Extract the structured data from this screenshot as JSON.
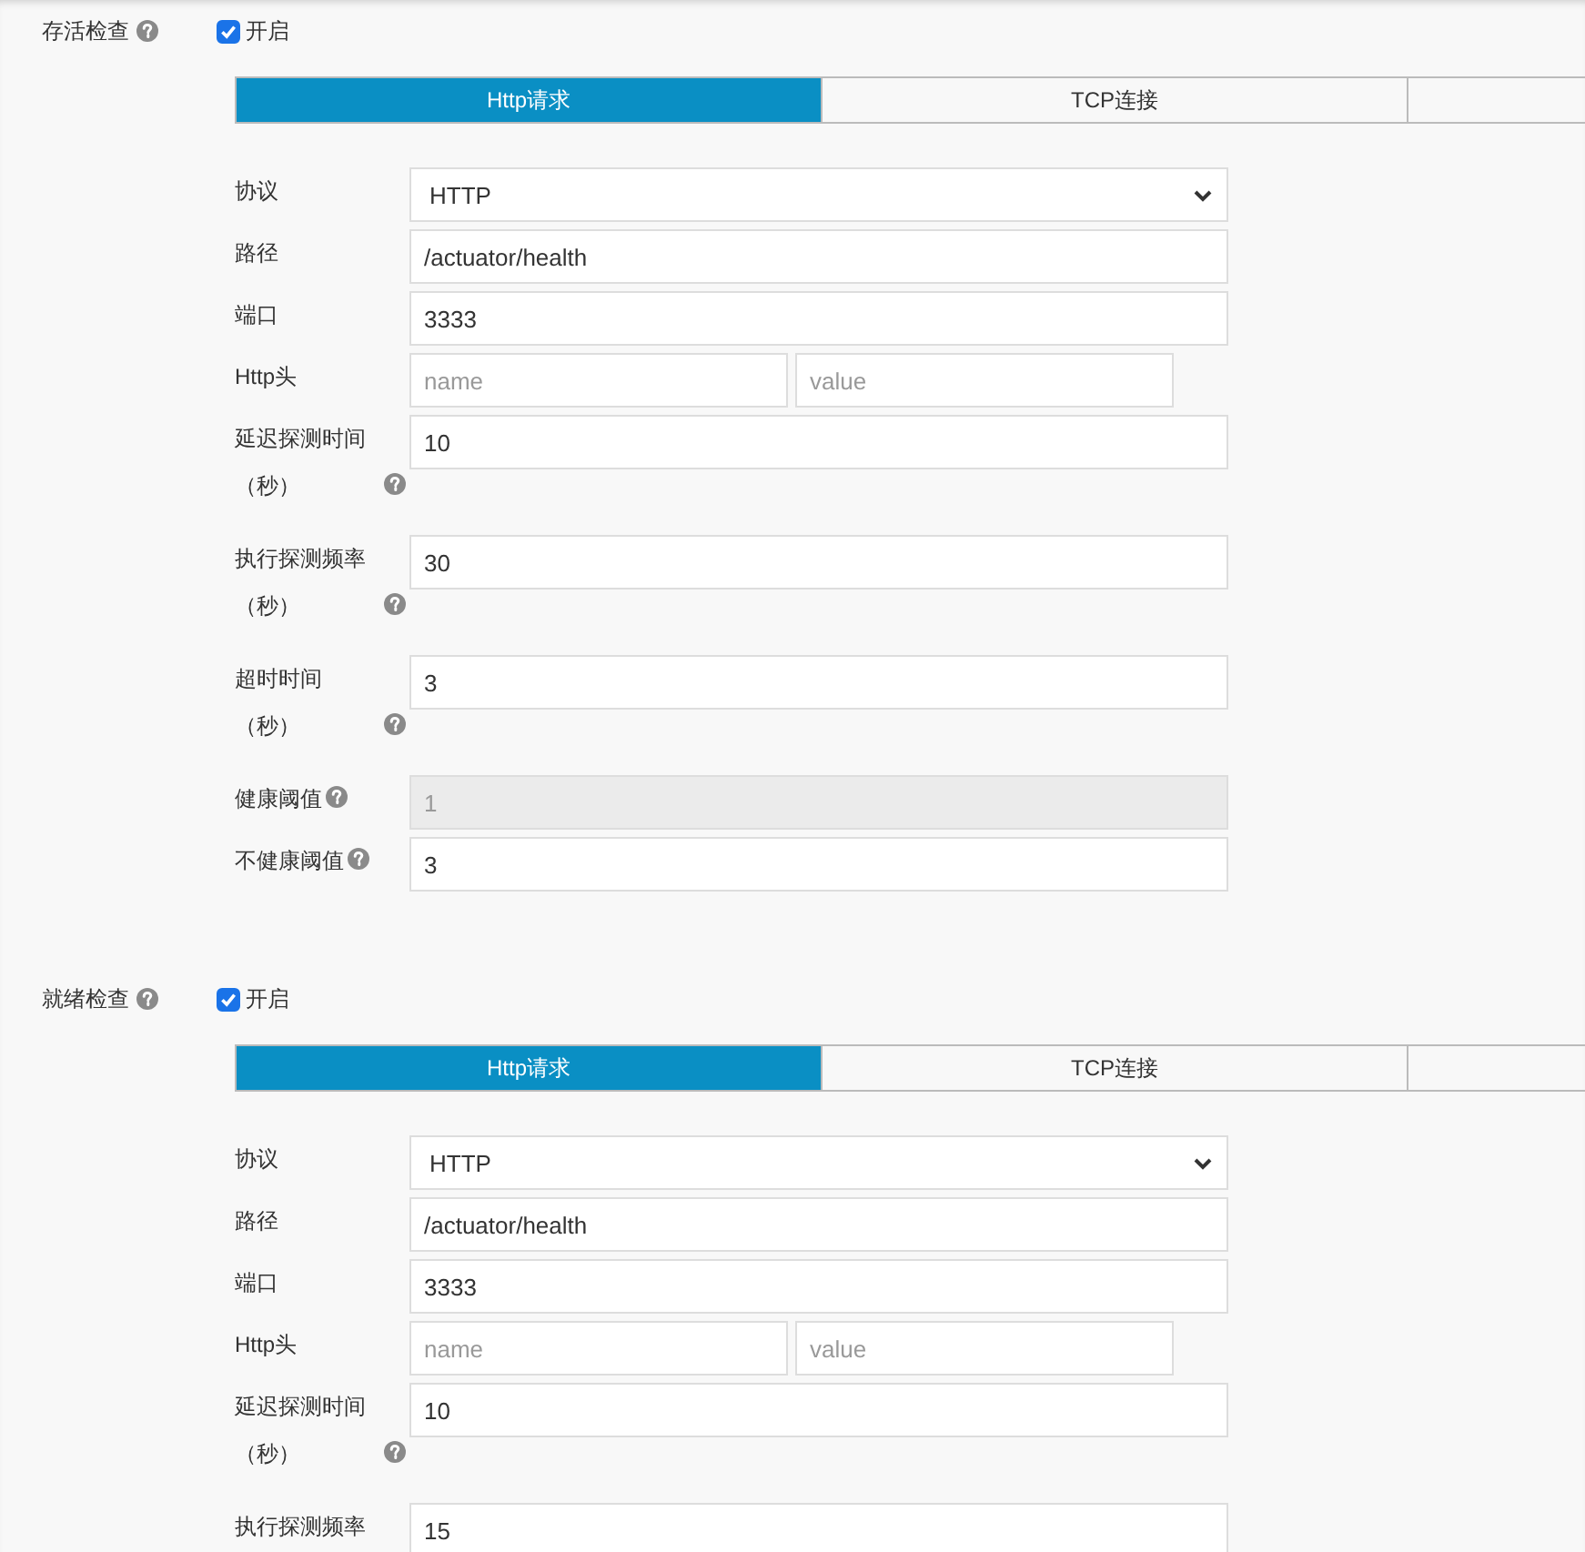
{
  "sections": [
    {
      "label": "存活检查",
      "help": true,
      "toggle": {
        "label": "开启",
        "checked": true
      },
      "tabs": [
        {
          "label": "Http请求",
          "selected": true
        },
        {
          "label": "TCP连接",
          "selected": false
        }
      ],
      "fields": [
        {
          "kind": "select",
          "label": "协议",
          "help": false,
          "disabled": false,
          "value": "HTTP"
        },
        {
          "kind": "text",
          "label": "路径",
          "help": false,
          "disabled": false,
          "value": "/actuator/health"
        },
        {
          "kind": "text",
          "label": "端口",
          "help": false,
          "disabled": false,
          "value": "3333"
        },
        {
          "kind": "pair",
          "label": "Http头",
          "help": false,
          "disabled": false,
          "key_placeholder": "name",
          "value_placeholder": "value"
        },
        {
          "kind": "text",
          "label": "延迟探测时间（秒）",
          "help": true,
          "disabled": false,
          "value": "10"
        },
        {
          "kind": "text",
          "label": "执行探测频率（秒）",
          "help": true,
          "disabled": false,
          "value": "30"
        },
        {
          "kind": "text",
          "label": "超时时间（秒）",
          "help": true,
          "disabled": false,
          "value": "3"
        },
        {
          "kind": "text",
          "label": "健康阈值",
          "help": true,
          "disabled": true,
          "value": "1"
        },
        {
          "kind": "text",
          "label": "不健康阈值",
          "help": true,
          "disabled": false,
          "value": "3"
        }
      ]
    },
    {
      "label": "就绪检查",
      "help": true,
      "toggle": {
        "label": "开启",
        "checked": true
      },
      "tabs": [
        {
          "label": "Http请求",
          "selected": true
        },
        {
          "label": "TCP连接",
          "selected": false
        }
      ],
      "fields": [
        {
          "kind": "select",
          "label": "协议",
          "help": false,
          "disabled": false,
          "value": "HTTP"
        },
        {
          "kind": "text",
          "label": "路径",
          "help": false,
          "disabled": false,
          "value": "/actuator/health"
        },
        {
          "kind": "text",
          "label": "端口",
          "help": false,
          "disabled": false,
          "value": "3333"
        },
        {
          "kind": "pair",
          "label": "Http头",
          "help": false,
          "disabled": false,
          "key_placeholder": "name",
          "value_placeholder": "value"
        },
        {
          "kind": "text",
          "label": "延迟探测时间（秒）",
          "help": true,
          "disabled": false,
          "value": "10"
        },
        {
          "kind": "text",
          "label": "执行探测频率",
          "help": false,
          "disabled": false,
          "value": "15"
        }
      ]
    }
  ]
}
